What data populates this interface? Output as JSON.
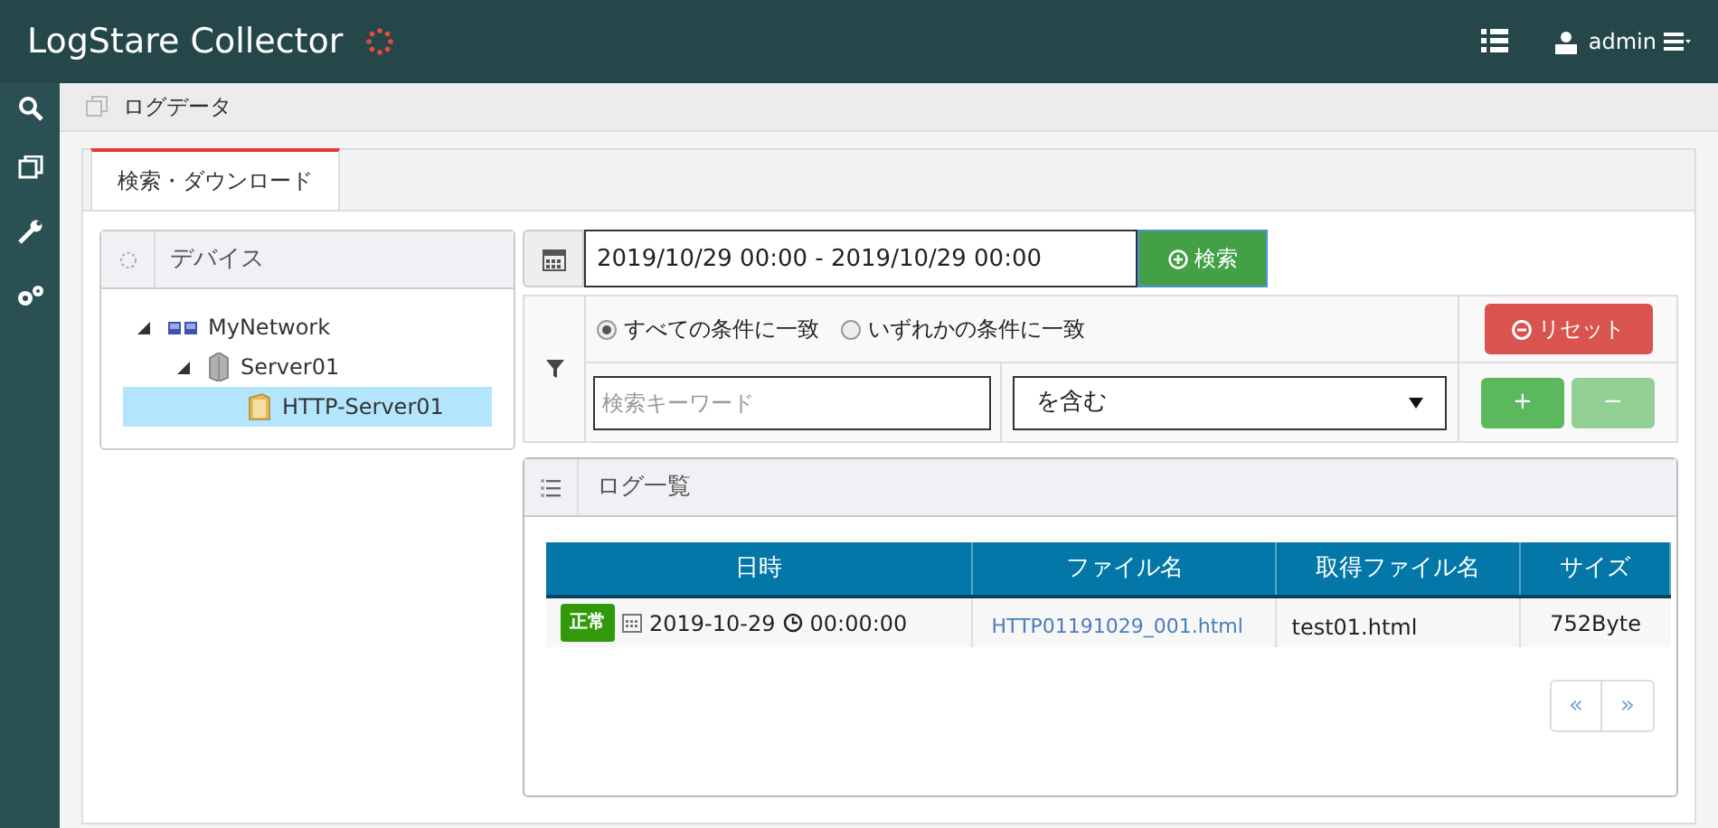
{
  "header": {
    "title": "LogStare Collector",
    "user": "admin"
  },
  "breadcrumb": "ログデータ",
  "tabs": [
    {
      "label": "検索・ダウンロード",
      "selected": true
    }
  ],
  "device_panel": {
    "title": "デバイス",
    "tree": [
      {
        "label": "MyNetwork",
        "kind": "network",
        "expanded": true,
        "selected": false,
        "children": [
          {
            "label": "Server01",
            "kind": "server",
            "expanded": true,
            "selected": false,
            "children": [
              {
                "label": "HTTP-Server01",
                "kind": "folder",
                "selected": true
              }
            ]
          }
        ]
      }
    ]
  },
  "search": {
    "date_range": "2019/10/29 00:00 - 2019/10/29 00:00",
    "search_button": "検索",
    "match_options": [
      {
        "label": "すべての条件に一致",
        "selected": true
      },
      {
        "label": "いずれかの条件に一致",
        "selected": false
      }
    ],
    "reset_button": "リセット",
    "keyword_placeholder": "検索キーワード",
    "condition": "を含む",
    "add_button": "+",
    "add_disabled": false,
    "remove_button": "−",
    "remove_disabled": true
  },
  "log_panel": {
    "title": "ログ一覧",
    "table": {
      "columns": [
        "日時",
        "ファイル名",
        "取得ファイル名",
        "サイズ"
      ],
      "rows": [
        {
          "status": "正常",
          "date": "2019-10-29",
          "time": "00:00:00",
          "file_name": "HTTP01191029_001.html",
          "fetched_file_name": "test01.html",
          "size": "752Byte"
        }
      ]
    },
    "pagination": {
      "prev": "«",
      "next": "»"
    }
  }
}
